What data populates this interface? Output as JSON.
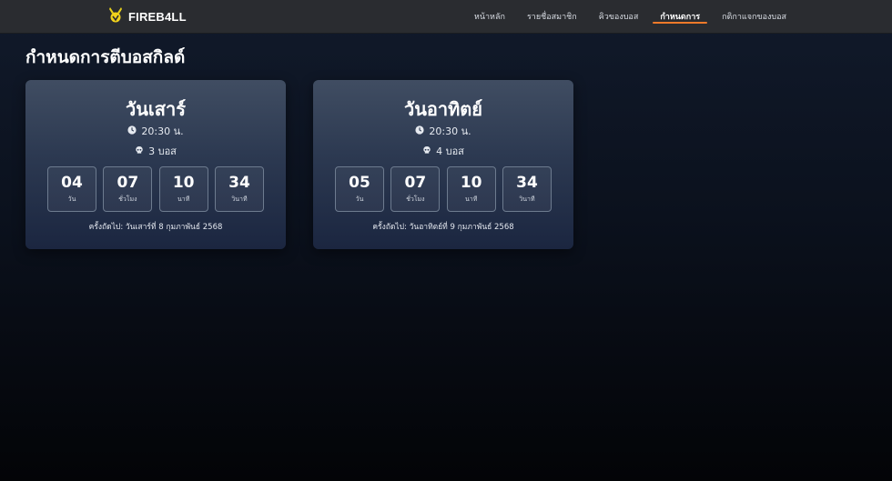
{
  "navbar": {
    "logo_icon": "fireball-logo-icon",
    "logo_text": "FIREB4LL",
    "items": [
      {
        "label": "หน้าหลัก",
        "active": false
      },
      {
        "label": "รายชื่อสมาชิก",
        "active": false
      },
      {
        "label": "คิวของบอส",
        "active": false
      },
      {
        "label": "กำหนดการ",
        "active": true
      },
      {
        "label": "กติกาแจกของบอส",
        "active": false
      }
    ],
    "active_underline_color": "#f07a2a"
  },
  "page": {
    "title": "กำหนดการตีบอสกิลด์"
  },
  "cards": [
    {
      "day": "วันเสาร์",
      "time": "20:30 น.",
      "time_icon": "clock-icon",
      "bosses": "3 บอส",
      "boss_icon": "skull-icon",
      "countdown": [
        {
          "value": "04",
          "unit": "วัน"
        },
        {
          "value": "07",
          "unit": "ชั่วโมง"
        },
        {
          "value": "10",
          "unit": "นาที"
        },
        {
          "value": "34",
          "unit": "วินาที"
        }
      ],
      "next": "ครั้งถัดไป: วันเสาร์ที่ 8 กุมภาพันธ์ 2568"
    },
    {
      "day": "วันอาทิตย์",
      "time": "20:30 น.",
      "time_icon": "clock-icon",
      "bosses": "4 บอส",
      "boss_icon": "skull-icon",
      "countdown": [
        {
          "value": "05",
          "unit": "วัน"
        },
        {
          "value": "07",
          "unit": "ชั่วโมง"
        },
        {
          "value": "10",
          "unit": "นาที"
        },
        {
          "value": "34",
          "unit": "วินาที"
        }
      ],
      "next": "ครั้งถัดไป: วันอาทิตย์ที่ 9 กุมภาพันธ์ 2568"
    }
  ]
}
